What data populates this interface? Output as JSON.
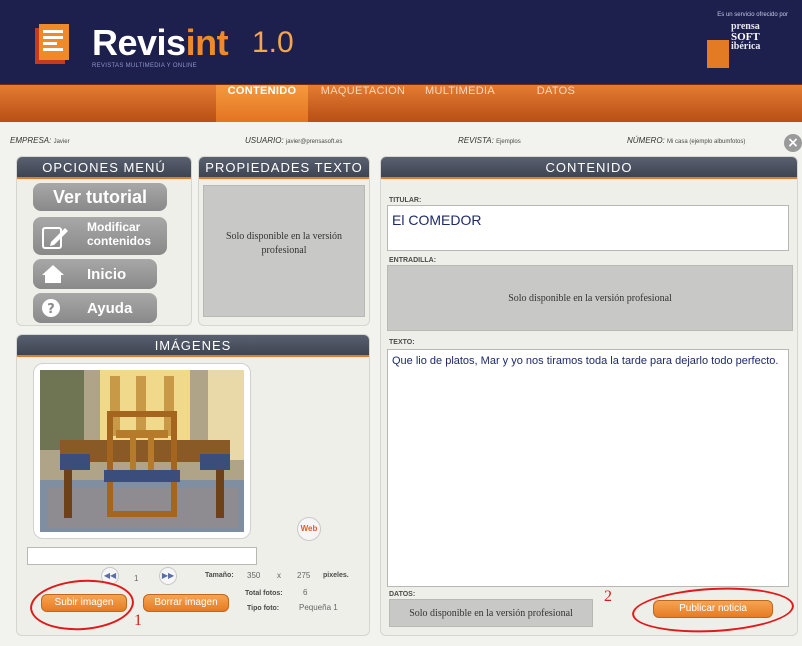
{
  "header": {
    "brand_main": "Revis",
    "brand_accent": "int",
    "version": "1.0",
    "tagline": "REVISTAS MULTIMEDIA Y ONLINE",
    "service_text": "Es un servicio ofrecido por",
    "partner_line1": "prensa",
    "partner_line2": "SOFT",
    "partner_line3": "ibérica"
  },
  "nav": {
    "items": [
      "CONTENIDO",
      "MAQUETACION",
      "MULTIMEDIA",
      "DATOS"
    ],
    "active": "CONTENIDO"
  },
  "info": {
    "empresa_label": "EMPRESA:",
    "empresa_value": "Javier",
    "usuario_label": "USUARIO:",
    "usuario_value": "javier@prensasoft.es",
    "revista_label": "REVISTA:",
    "revista_value": "Ejemplos",
    "numero_label": "NÚMERO:",
    "numero_value": "Mi casa (ejemplo albumfotos)"
  },
  "menu": {
    "title": "OPCIONES MENÚ",
    "ver_tutorial": "Ver tutorial",
    "modificar_1": "Modificar",
    "modificar_2": "contenidos",
    "inicio": "Inicio",
    "ayuda": "Ayuda"
  },
  "propiedades": {
    "title": "PROPIEDADES TEXTO",
    "disabled_text": "Solo disponible en la versión profesional"
  },
  "imagenes": {
    "title": "IMÁGENES",
    "web_label": "Web",
    "page_number": "1",
    "tamano_label": "Tamaño:",
    "width": "350",
    "times": "x",
    "height": "275",
    "units": "pixeles.",
    "total_label": "Total fotos:",
    "total_value": "6",
    "tipo_label": "Tipo foto:",
    "tipo_value": "Pequeña 1",
    "subir_label": "Subir imagen",
    "borrar_label": "Borrar imagen"
  },
  "contenido": {
    "title": "CONTENIDO",
    "titular_label": "TITULAR:",
    "titular_value": "El COMEDOR",
    "entradilla_label": "ENTRADILLA:",
    "entradilla_text": "Solo disponible en la versión profesional",
    "texto_label": "TEXTO:",
    "texto_value": " Que lio de platos, Mar y yo nos tiramos toda la tarde para dejarlo todo perfecto.",
    "datos_label": "DATOS:",
    "datos_text": "Solo disponible en la versión profesional",
    "publicar_label": "Publicar noticia"
  },
  "annotations": {
    "one": "1",
    "two": "2"
  },
  "colors": {
    "header_bg": "#1d1f4d",
    "accent_orange": "#e77b23",
    "panel_header": "#4a505e",
    "annotation_red": "#e01a1a"
  }
}
